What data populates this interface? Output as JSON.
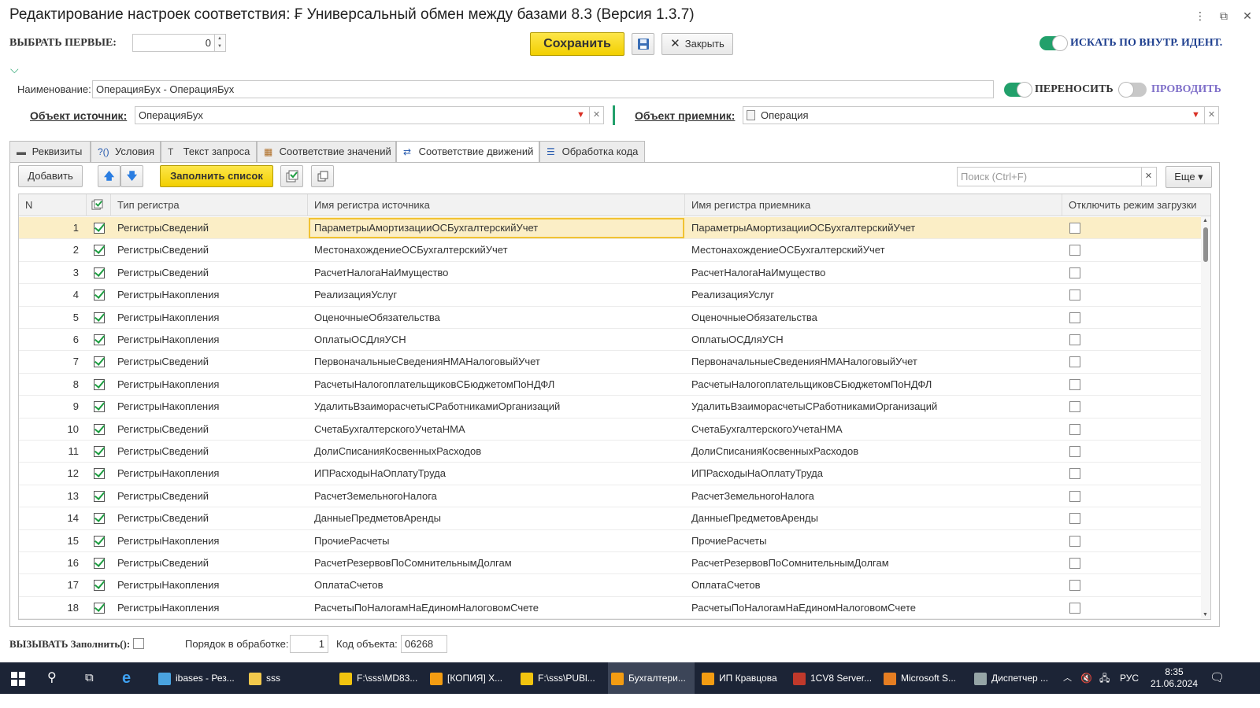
{
  "window": {
    "title": "Редактирование настроек соответствия: ₣ Универсальный обмен между базами 8.3 (Версия 1.3.7)",
    "menu_icon": "⋮",
    "restore_icon": "⧉",
    "close_icon": "✕"
  },
  "top": {
    "select_first_label": "ВЫБРАТЬ ПЕРВЫЕ:",
    "select_first_value": "0",
    "save_label": "Сохранить",
    "close_label": "Закрыть",
    "search_internal_label": "ИСКАТЬ ПО ВНУТР. ИДЕНТ.",
    "search_internal_on": true
  },
  "form": {
    "name_label": "Наименование:",
    "name_value": "ОперацияБух - ОперацияБух",
    "transfer_label": "ПЕРЕНОСИТЬ",
    "transfer_on": true,
    "post_label": "ПРОВОДИТЬ",
    "post_on": false,
    "source_label": "Объект источник:",
    "source_value": "ОперацияБух",
    "target_label": "Объект приемник:",
    "target_value": "Операция"
  },
  "tabs": [
    {
      "label": "Реквизиты",
      "icon": "minus-icon",
      "glyph": "▬",
      "active": false
    },
    {
      "label": "Условия",
      "icon": "question-icon",
      "glyph": "?()",
      "active": false
    },
    {
      "label": "Текст запроса",
      "icon": "text-icon",
      "glyph": "T",
      "active": false
    },
    {
      "label": "Соответствие значений",
      "icon": "table-icon",
      "glyph": "▦",
      "active": false
    },
    {
      "label": "Соответствие движений",
      "icon": "register-icon",
      "glyph": "⇄",
      "active": true
    },
    {
      "label": "Обработка кода",
      "icon": "code-icon",
      "glyph": "☰",
      "active": false
    }
  ],
  "toolbar": {
    "add_label": "Добавить",
    "up_icon": "🡅",
    "down_icon": "🡇",
    "fill_label": "Заполнить список",
    "search_placeholder": "Поиск (Ctrl+F)",
    "more_label": "Еще ▾"
  },
  "table": {
    "columns": [
      "N",
      "",
      "Тип регистра",
      "Имя регистра источника",
      "Имя регистра приемника",
      "Отключить режим загрузки"
    ],
    "rows": [
      {
        "n": "1",
        "checked": true,
        "type": "РегистрыСведений",
        "source": "ПараметрыАмортизацииОСБухгалтерскийУчет",
        "target": "ПараметрыАмортизацииОСБухгалтерскийУчет",
        "disable": false
      },
      {
        "n": "2",
        "checked": true,
        "type": "РегистрыСведений",
        "source": "МестонахождениеОСБухгалтерскийУчет",
        "target": "МестонахождениеОСБухгалтерскийУчет",
        "disable": false
      },
      {
        "n": "3",
        "checked": true,
        "type": "РегистрыСведений",
        "source": "РасчетНалогаНаИмущество",
        "target": "РасчетНалогаНаИмущество",
        "disable": false
      },
      {
        "n": "4",
        "checked": true,
        "type": "РегистрыНакопления",
        "source": "РеализацияУслуг",
        "target": "РеализацияУслуг",
        "disable": false
      },
      {
        "n": "5",
        "checked": true,
        "type": "РегистрыНакопления",
        "source": "ОценочныеОбязательства",
        "target": "ОценочныеОбязательства",
        "disable": false
      },
      {
        "n": "6",
        "checked": true,
        "type": "РегистрыНакопления",
        "source": "ОплатыОСДляУСН",
        "target": "ОплатыОСДляУСН",
        "disable": false
      },
      {
        "n": "7",
        "checked": true,
        "type": "РегистрыСведений",
        "source": "ПервоначальныеСведенияНМАНалоговыйУчет",
        "target": "ПервоначальныеСведенияНМАНалоговыйУчет",
        "disable": false
      },
      {
        "n": "8",
        "checked": true,
        "type": "РегистрыНакопления",
        "source": "РасчетыНалогоплательщиковСБюджетомПоНДФЛ",
        "target": "РасчетыНалогоплательщиковСБюджетомПоНДФЛ",
        "disable": false
      },
      {
        "n": "9",
        "checked": true,
        "type": "РегистрыНакопления",
        "source": "УдалитьВзаиморасчетыСРаботникамиОрганизаций",
        "target": "УдалитьВзаиморасчетыСРаботникамиОрганизаций",
        "disable": false
      },
      {
        "n": "10",
        "checked": true,
        "type": "РегистрыСведений",
        "source": "СчетаБухгалтерскогоУчетаНМА",
        "target": "СчетаБухгалтерскогоУчетаНМА",
        "disable": false
      },
      {
        "n": "11",
        "checked": true,
        "type": "РегистрыСведений",
        "source": "ДолиСписанияКосвенныхРасходов",
        "target": "ДолиСписанияКосвенныхРасходов",
        "disable": false
      },
      {
        "n": "12",
        "checked": true,
        "type": "РегистрыНакопления",
        "source": "ИПРасходыНаОплатуТруда",
        "target": "ИПРасходыНаОплатуТруда",
        "disable": false
      },
      {
        "n": "13",
        "checked": true,
        "type": "РегистрыСведений",
        "source": "РасчетЗемельногоНалога",
        "target": "РасчетЗемельногоНалога",
        "disable": false
      },
      {
        "n": "14",
        "checked": true,
        "type": "РегистрыСведений",
        "source": "ДанныеПредметовАренды",
        "target": "ДанныеПредметовАренды",
        "disable": false
      },
      {
        "n": "15",
        "checked": true,
        "type": "РегистрыНакопления",
        "source": "ПрочиеРасчеты",
        "target": "ПрочиеРасчеты",
        "disable": false
      },
      {
        "n": "16",
        "checked": true,
        "type": "РегистрыСведений",
        "source": "РасчетРезервовПоСомнительнымДолгам",
        "target": "РасчетРезервовПоСомнительнымДолгам",
        "disable": false
      },
      {
        "n": "17",
        "checked": true,
        "type": "РегистрыНакопления",
        "source": "ОплатаСчетов",
        "target": "ОплатаСчетов",
        "disable": false
      },
      {
        "n": "18",
        "checked": true,
        "type": "РегистрыНакопления",
        "source": "РасчетыПоНалогамНаЕдиномНалоговомСчете",
        "target": "РасчетыПоНалогамНаЕдиномНалоговомСчете",
        "disable": false
      }
    ]
  },
  "bottom": {
    "call_fill_label": "ВЫЗЫВАТЬ Заполнить():",
    "order_label": "Порядок в обработке:",
    "order_value": "1",
    "code_label": "Код объекта:",
    "code_value": "06268"
  },
  "taskbar": {
    "items": [
      {
        "label": "ibases - Рез...",
        "icon": "database-icon",
        "color": "#4aa3df"
      },
      {
        "label": "sss",
        "icon": "folder-icon",
        "color": "#f2c94c"
      },
      {
        "label": "F:\\sss\\MD83...",
        "icon": "app-icon",
        "color": "#f1c40f"
      },
      {
        "label": "[КОПИЯ] Х...",
        "icon": "1c-icon",
        "color": "#f39c12"
      },
      {
        "label": "F:\\sss\\PUBl...",
        "icon": "app-icon",
        "color": "#f1c40f"
      },
      {
        "label": "Бухгалтери...",
        "icon": "1c-icon",
        "color": "#f39c12"
      },
      {
        "label": "ИП Кравцова",
        "icon": "1c-icon",
        "color": "#f39c12"
      },
      {
        "label": "1CV8 Server...",
        "icon": "server-icon",
        "color": "#c0392b"
      },
      {
        "label": "Microsoft S...",
        "icon": "sql-icon",
        "color": "#e67e22"
      },
      {
        "label": "Диспетчер ...",
        "icon": "monitor-icon",
        "color": "#95a5a6"
      }
    ],
    "tray_lang": "РУС",
    "time": "8:35",
    "date": "21.06.2024"
  }
}
